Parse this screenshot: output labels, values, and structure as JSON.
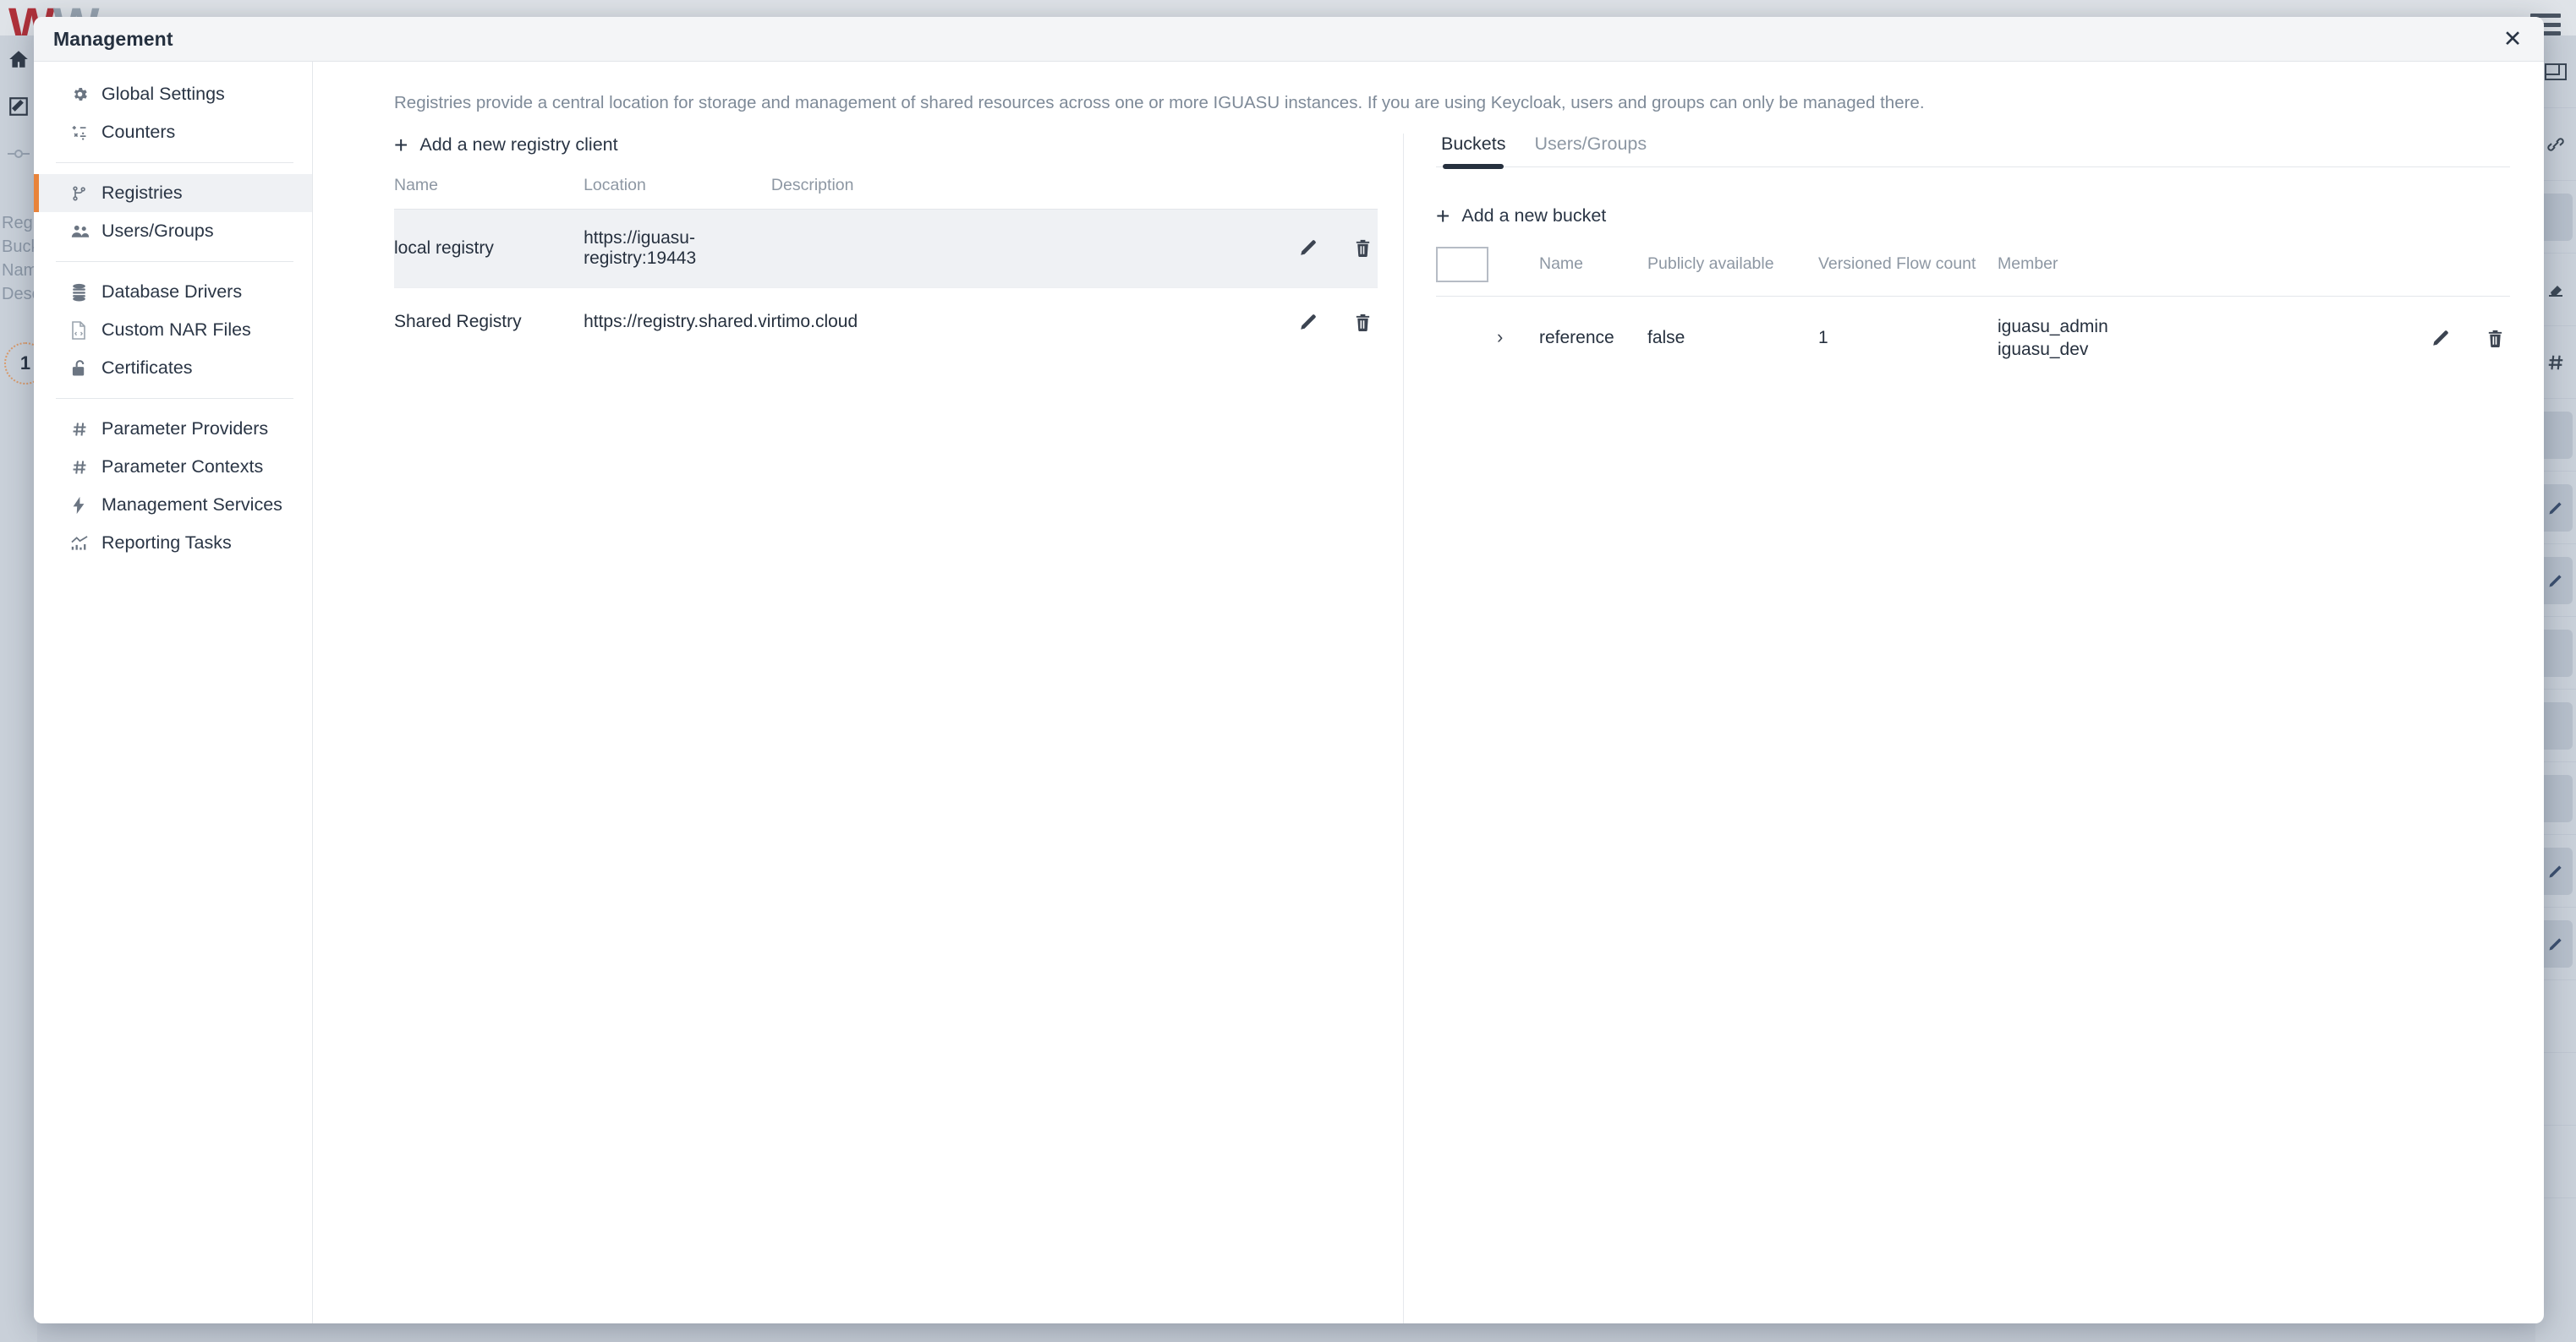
{
  "background": {
    "logo_w1": "W",
    "logo_w2": "W",
    "hamburger_icon": "hamburger-menu-icon",
    "left_rail_icons": [
      "home-icon",
      "edit-document-icon",
      "node-connector-icon"
    ],
    "left_texts": [
      "Regis",
      "Buck",
      "Nam",
      "Desc"
    ],
    "count_badge": "1",
    "right_rail_icons": [
      "window-icon",
      "link-icon",
      "chip-icon",
      "eraser-icon",
      "hash-icon",
      "chip-icon",
      "pencil-chip-icon",
      "pencil-chip-icon",
      "chip-icon",
      "chip-icon",
      "chip-icon",
      "pencil-chip-icon",
      "pencil-chip-icon"
    ]
  },
  "dialog": {
    "title": "Management",
    "close_icon": "close-icon",
    "close_label": "✕"
  },
  "sidebar": {
    "groups": [
      {
        "items": [
          {
            "label": "Global Settings",
            "icon": "gear-icon",
            "active": false
          },
          {
            "label": "Counters",
            "icon": "counters-icon",
            "active": false
          }
        ]
      },
      {
        "items": [
          {
            "label": "Registries",
            "icon": "registry-branch-icon",
            "active": true
          },
          {
            "label": "Users/Groups",
            "icon": "users-icon",
            "active": false
          }
        ]
      },
      {
        "items": [
          {
            "label": "Database Drivers",
            "icon": "database-icon",
            "active": false
          },
          {
            "label": "Custom NAR Files",
            "icon": "file-code-icon",
            "active": false
          },
          {
            "label": "Certificates",
            "icon": "lock-open-icon",
            "active": false
          }
        ]
      },
      {
        "items": [
          {
            "label": "Parameter Providers",
            "icon": "hash-icon",
            "active": false
          },
          {
            "label": "Parameter Contexts",
            "icon": "hash-icon",
            "active": false
          },
          {
            "label": "Management Services",
            "icon": "lightning-icon",
            "active": false
          },
          {
            "label": "Reporting Tasks",
            "icon": "chart-line-icon",
            "active": false
          }
        ]
      }
    ]
  },
  "content": {
    "description": "Registries provide a central location for storage and management of shared resources across one or more IGUASU instances. If you are using Keycloak, users and groups can only be managed there.",
    "registries": {
      "add_label": "Add a new registry client",
      "add_icon": "plus-icon",
      "columns": [
        "Name",
        "Location",
        "Description"
      ],
      "rows": [
        {
          "name": "local registry",
          "location": "https://iguasu-registry:19443",
          "description": "",
          "selected": true,
          "edit_icon": "pencil-icon",
          "delete_icon": "trash-icon"
        },
        {
          "name": "Shared Registry",
          "location": "https://registry.shared.virtimo.cloud",
          "description": "",
          "selected": false,
          "edit_icon": "pencil-icon",
          "delete_icon": "trash-icon"
        }
      ]
    },
    "detail": {
      "tabs": [
        {
          "label": "Buckets",
          "active": true
        },
        {
          "label": "Users/Groups",
          "active": false
        }
      ],
      "add_label": "Add a new bucket",
      "add_icon": "plus-icon",
      "columns": [
        "Name",
        "Publicly available",
        "Versioned Flow count",
        "Member"
      ],
      "select_all_icon": "checkbox-unchecked-icon",
      "rows": [
        {
          "expand_icon": "chevron-right-icon",
          "expand_glyph": "›",
          "name": "reference",
          "publicly_available": "false",
          "versioned_flow_count": "1",
          "members": [
            "iguasu_admin",
            "iguasu_dev"
          ],
          "edit_icon": "pencil-icon",
          "delete_icon": "trash-icon"
        }
      ]
    }
  },
  "colors": {
    "accent_orange": "#e8833a",
    "dialog_header": "#f4f5f7",
    "row_selected": "#eff1f4",
    "text_primary": "#26303e",
    "text_muted": "#8d97a3",
    "logo_red": "#b0313a"
  }
}
